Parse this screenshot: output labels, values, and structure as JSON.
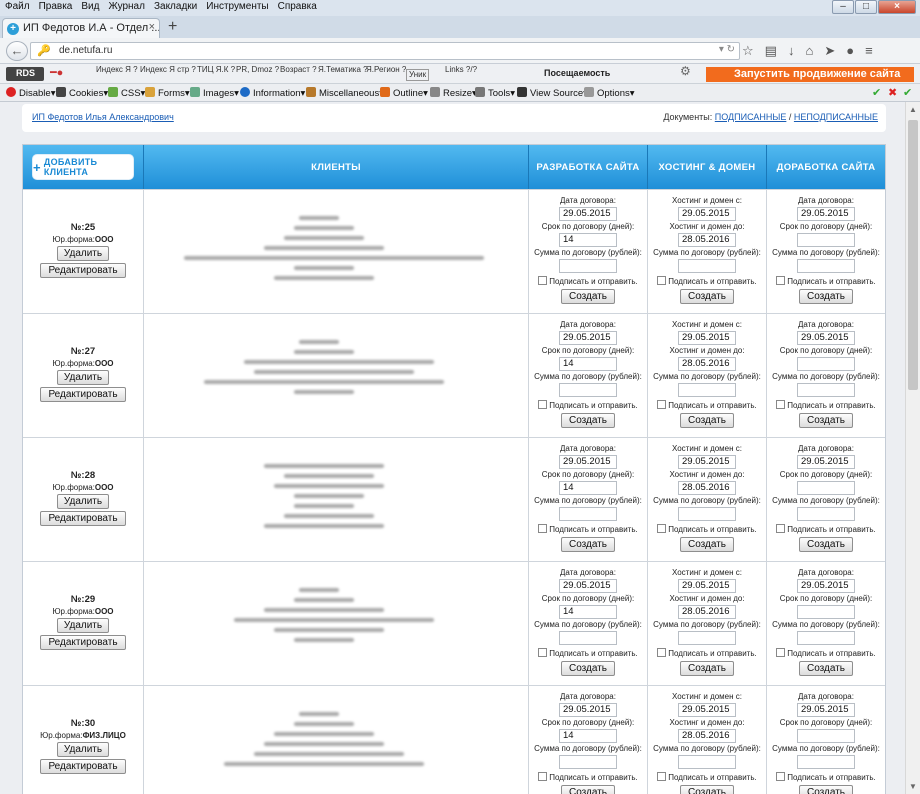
{
  "menubar": [
    "Файл",
    "Правка",
    "Вид",
    "Журнал",
    "Закладки",
    "Инструменты",
    "Справка"
  ],
  "tab": {
    "title": "ИП Федотов И.А - Отдел ...",
    "favicon": "+",
    "close": "×"
  },
  "newtab": "+",
  "url": "de.netufa.ru",
  "toolbar1": {
    "rds": "RDS",
    "items": [
      "Индекс Я ?",
      "Индекс Я стр ?",
      "ТИЦ Я.К ?",
      "PR, Dmoz ?",
      "Возраст ?",
      "Я.Тематика ?",
      "Я.Регион ?",
      "Уник",
      "Links ?/?"
    ],
    "poseshchaemost": "Посещаемость",
    "promo": "Запустить продвижение сайта"
  },
  "toolbar2": [
    "Disable",
    "Cookies",
    "CSS",
    "Forms",
    "Images",
    "Information",
    "Miscellaneous",
    "Outline",
    "Resize",
    "Tools",
    "View Source",
    "Options"
  ],
  "user": {
    "name": "ИП Федотов Илья Александрович",
    "docs_label": "Документы:",
    "signed": "ПОДПИСАННЫЕ",
    "sep": "/",
    "unsigned": "НЕПОДПИСАННЫЕ"
  },
  "header": {
    "add_client": "ДОБАВИТЬ КЛИЕНТА",
    "clients": "КЛИЕНТЫ",
    "dev": "РАЗРАБОТКА САЙТА",
    "hosting": "ХОСТИНГ & ДОМЕН",
    "rework": "ДОРАБОТКА САЙТА"
  },
  "labels": {
    "contract_date": "Дата договора:",
    "term_days": "Срок по договору (дней):",
    "sum_rub": "Сумма по договору (рублей):",
    "host_from": "Хостинг и домен с:",
    "host_to": "Хостинг и домен до:",
    "sign_send": "Подписать и отправить.",
    "create": "Создать",
    "delete": "Удалить",
    "edit": "Редактировать",
    "yur": "Юр.форма:"
  },
  "rows": [
    {
      "num": "№:25",
      "yur": "ООО",
      "dev_date": "29.05.2015",
      "dev_term": "14",
      "host_from": "29.05.2015",
      "host_to": "28.05.2016",
      "rework_date": "29.05.2015"
    },
    {
      "num": "№:27",
      "yur": "ООО",
      "dev_date": "29.05.2015",
      "dev_term": "14",
      "host_from": "29.05.2015",
      "host_to": "28.05.2016",
      "rework_date": "29.05.2015"
    },
    {
      "num": "№:28",
      "yur": "ООО",
      "dev_date": "29.05.2015",
      "dev_term": "14",
      "host_from": "29.05.2015",
      "host_to": "28.05.2016",
      "rework_date": "29.05.2015"
    },
    {
      "num": "№:29",
      "yur": "ООО",
      "dev_date": "29.05.2015",
      "dev_term": "14",
      "host_from": "29.05.2015",
      "host_to": "28.05.2016",
      "rework_date": "29.05.2015"
    },
    {
      "num": "№:30",
      "yur": "ФИЗ.ЛИЦО",
      "dev_date": "29.05.2015",
      "dev_term": "14",
      "host_from": "29.05.2015",
      "host_to": "28.05.2016",
      "rework_date": "29.05.2015"
    }
  ]
}
